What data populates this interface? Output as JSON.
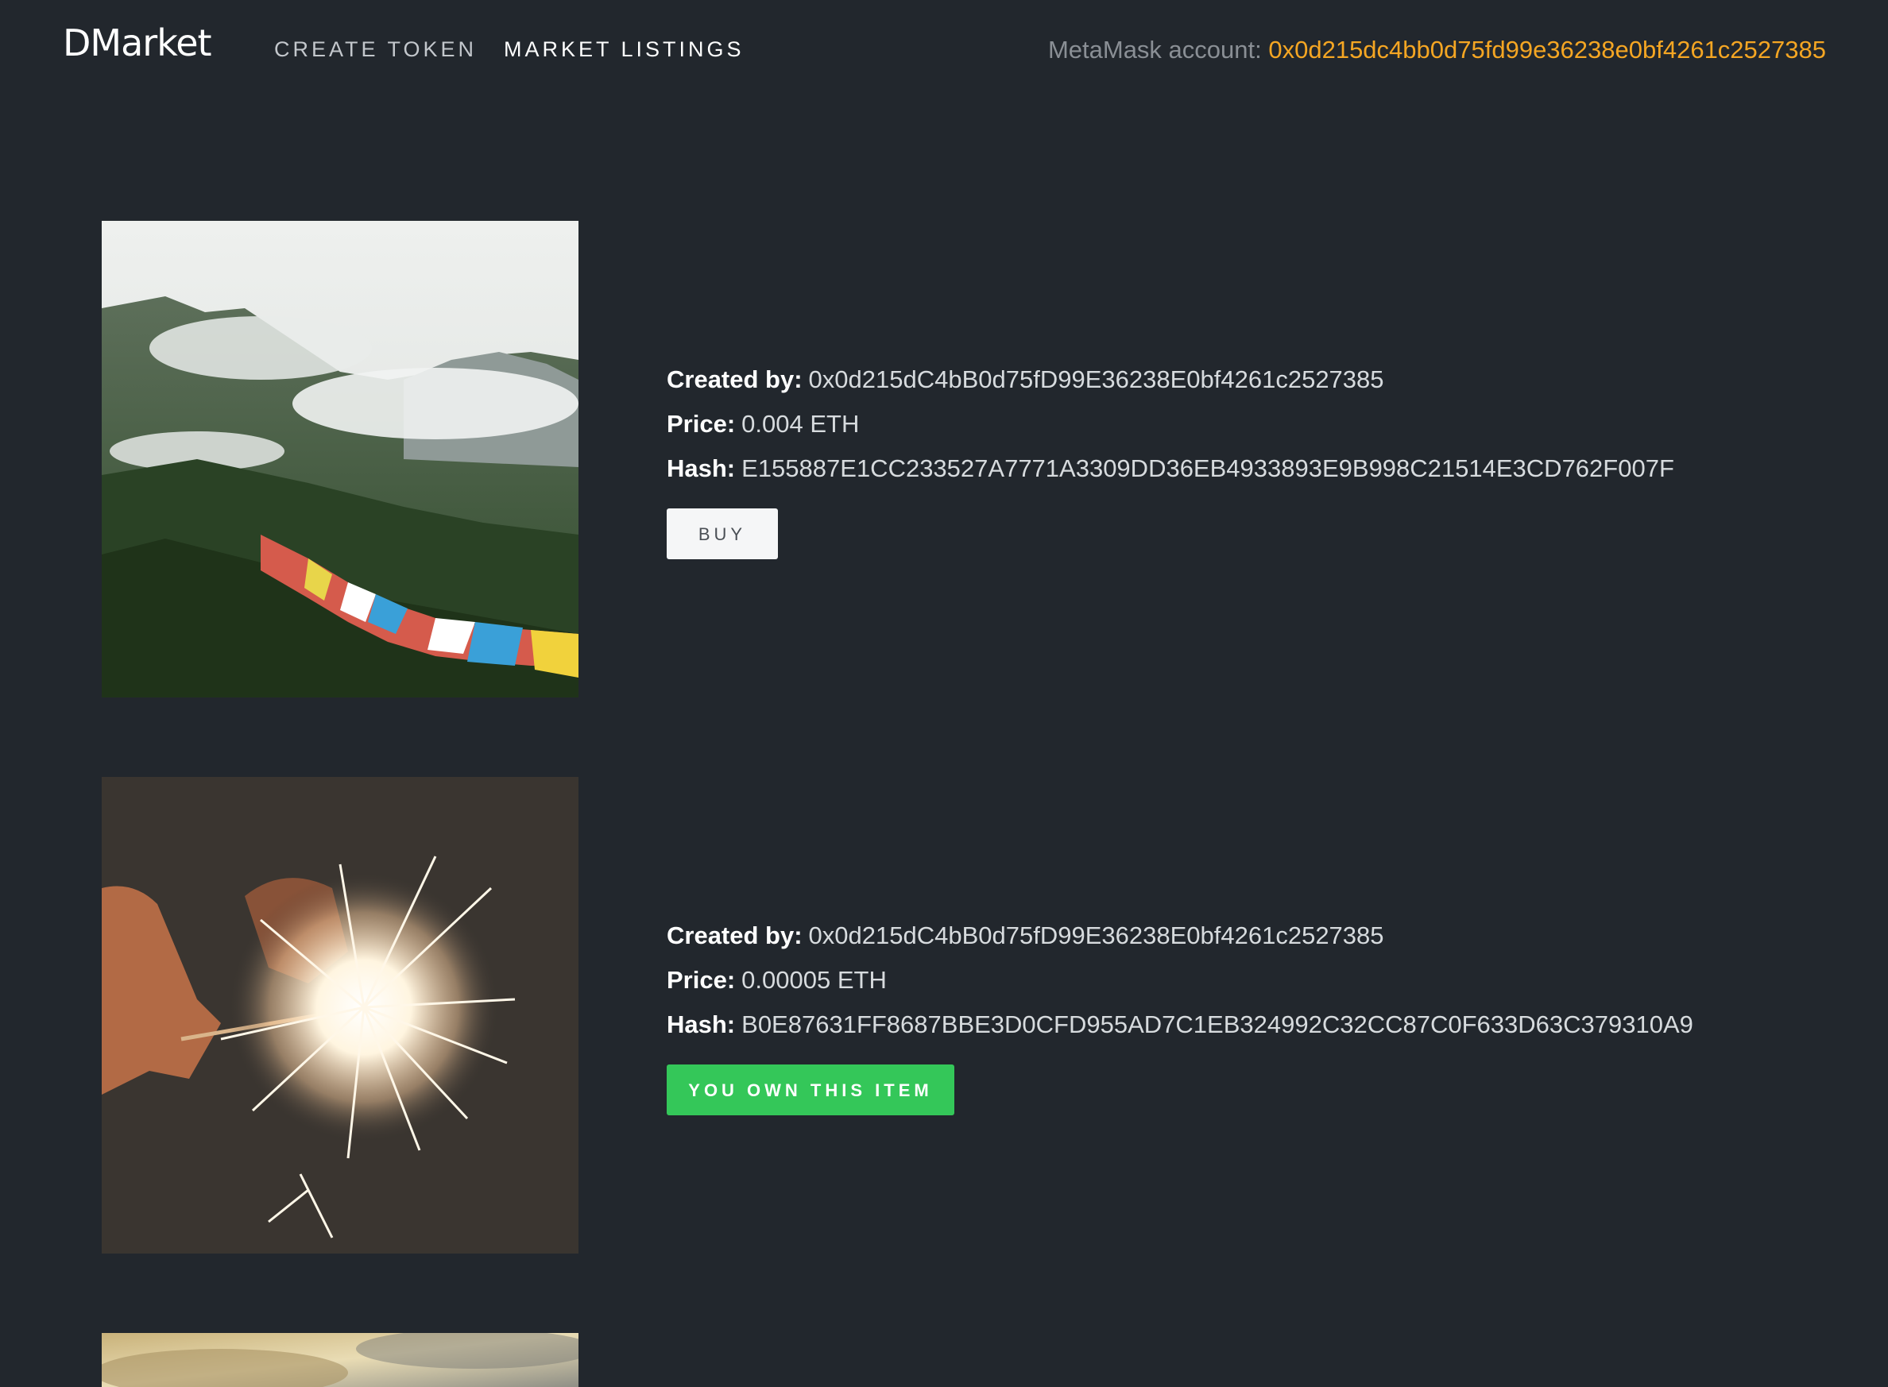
{
  "nav": {
    "brand": "DMarket",
    "links": [
      "CREATE TOKEN",
      "MARKET LISTINGS"
    ],
    "account_label": "MetaMask account: ",
    "account_address": "0x0d215dc4bb0d75fd99e36238e0bf4261c2527385"
  },
  "labels": {
    "created_by": "Created by:",
    "price": "Price:",
    "hash": "Hash:"
  },
  "listings": [
    {
      "image": "mountain-prayer-flags",
      "created_by": "0x0d215dC4bB0d75fD99E36238E0bf4261c2527385",
      "price": "0.004 ETH",
      "hash": "E155887E1CC233527A7771A3309DD36EB4933893E9B998C21514E3CD762F007F",
      "button": "BUY"
    },
    {
      "image": "sparkler",
      "created_by": "0x0d215dC4bB0d75fD99E36238E0bf4261c2527385",
      "price": "0.00005 ETH",
      "hash": "B0E87631FF8687BBE3D0CFD955AD7C1EB324992C32CC87C0F633D63C379310A9",
      "button": "YOU OWN THIS ITEM"
    },
    {
      "image": "sunset-sky"
    }
  ],
  "colors": {
    "background": "#22272d",
    "account_address": "#f5a623",
    "owned_button": "#34c759"
  }
}
